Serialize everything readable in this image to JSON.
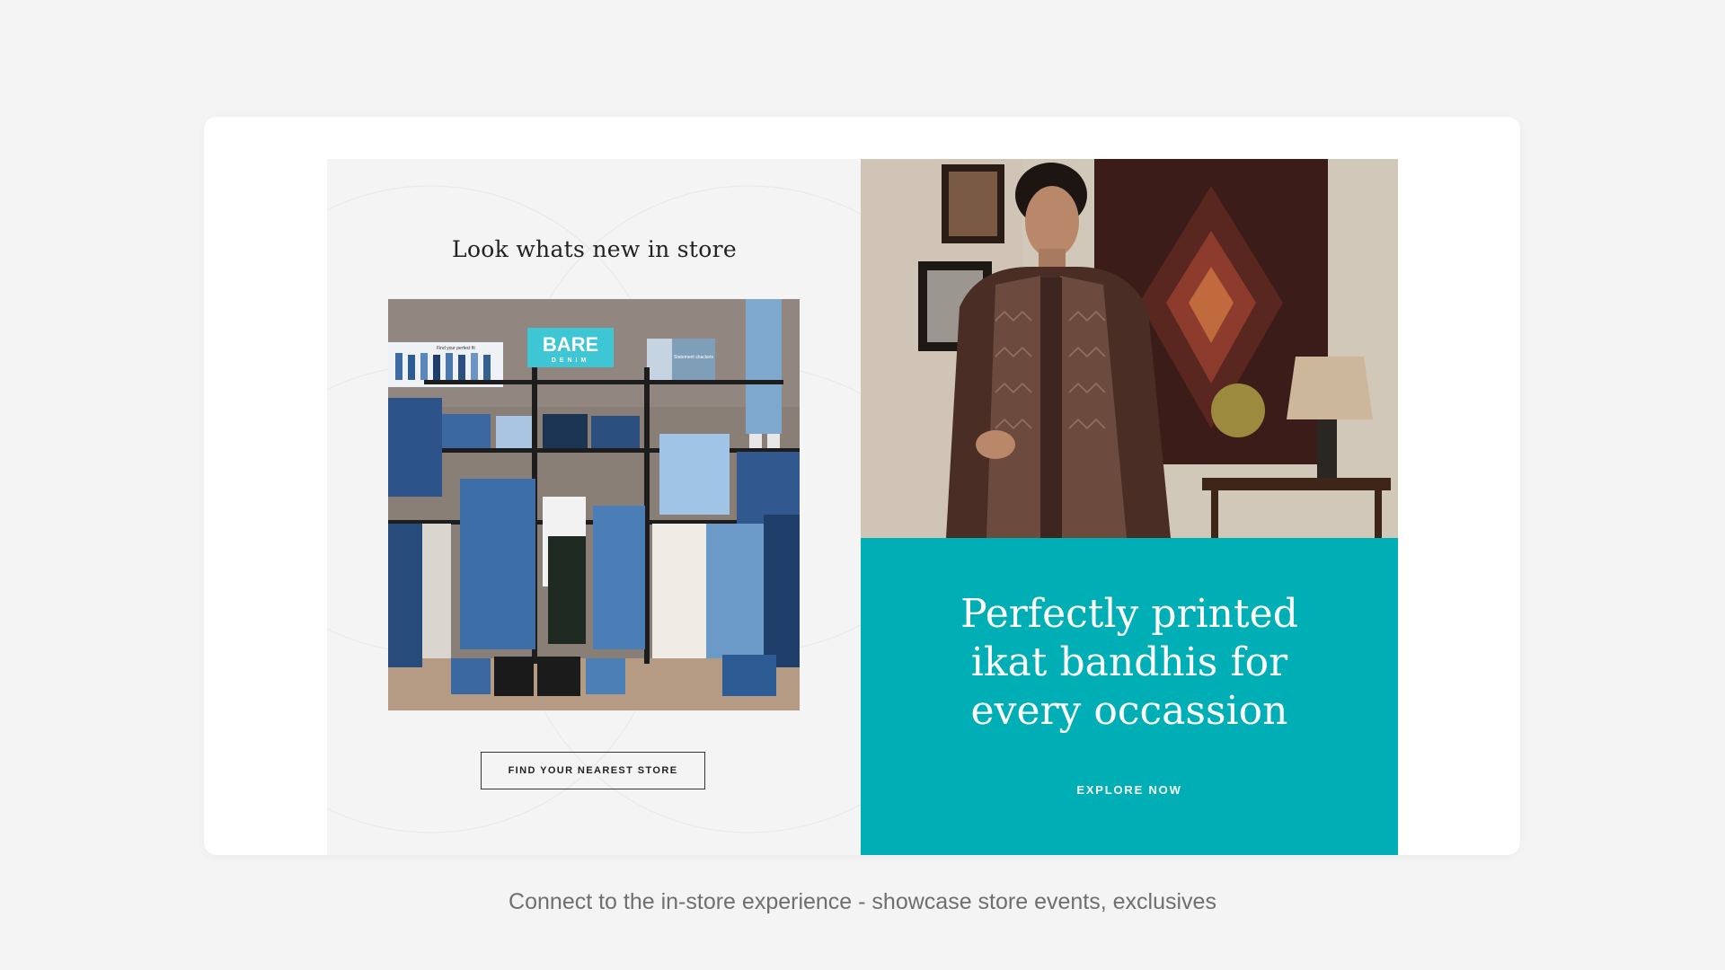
{
  "left_panel": {
    "title": "Look whats new in store",
    "photo": {
      "sign_brand": "BARE",
      "sign_sub": "DENIM",
      "poster_left": "Find your perfect fit",
      "poster_right": "Statement shackets"
    },
    "button_label": "FIND YOUR NEAREST STORE"
  },
  "right_panel": {
    "promo_title_lines": [
      "Perfectly printed",
      "ikat bandhis for",
      "every occassion"
    ],
    "explore_label": "EXPLORE NOW"
  },
  "caption": "Connect to the in-store experience - showcase store events, exclusives",
  "colors": {
    "page_bg": "#f4f4f4",
    "card_bg": "#ffffff",
    "left_panel_bg": "#f4f4f4",
    "promo_teal": "#00afb5",
    "sign_cyan": "#3fc6d4"
  }
}
